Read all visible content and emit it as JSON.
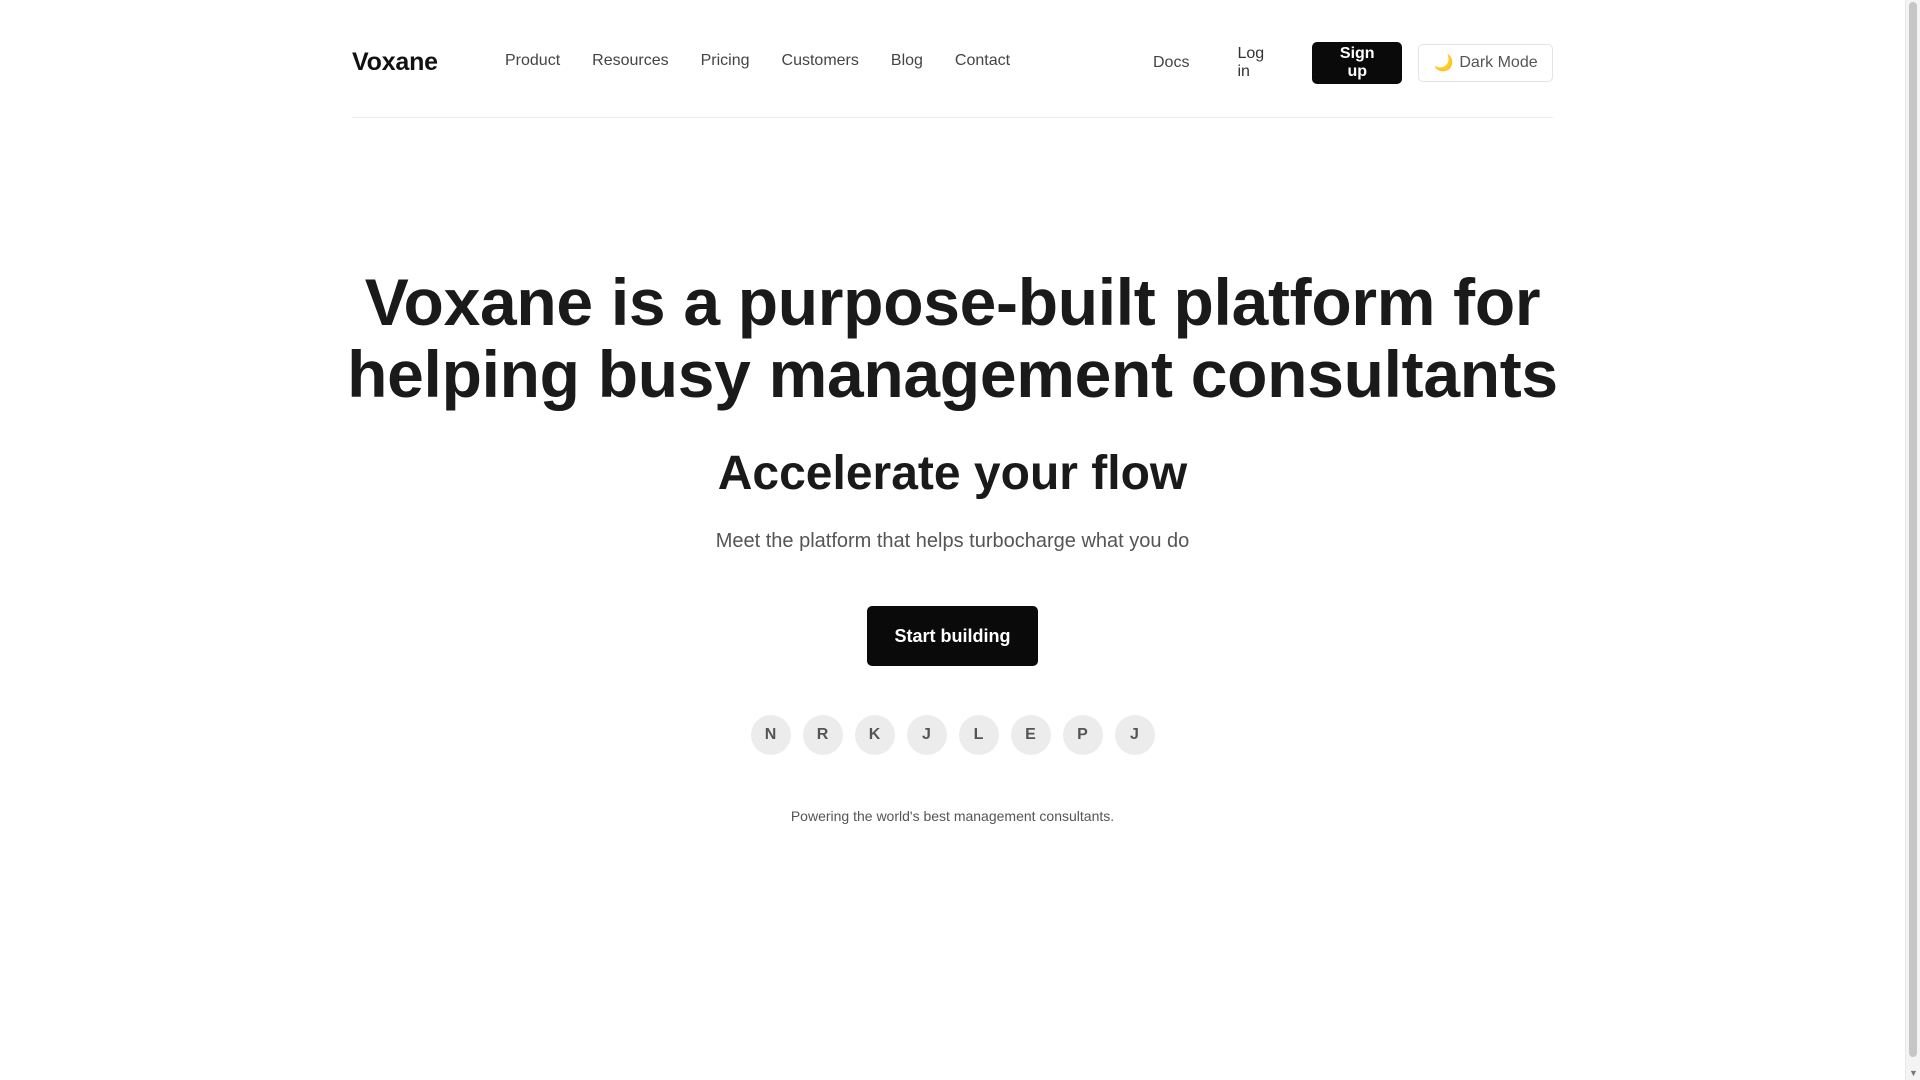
{
  "header": {
    "logo": "Voxane",
    "nav": [
      "Product",
      "Resources",
      "Pricing",
      "Customers",
      "Blog",
      "Contact"
    ],
    "docs": "Docs",
    "login": "Log in",
    "signup": "Sign up",
    "darkmode": "Dark Mode"
  },
  "hero": {
    "headline_line1": "Voxane is a purpose-built platform for",
    "headline_line2": "helping busy management consultants",
    "subheadline": "Accelerate your flow",
    "tagline": "Meet the platform that helps turbocharge what you do",
    "cta": "Start building",
    "avatars": [
      "N",
      "R",
      "K",
      "J",
      "L",
      "E",
      "P",
      "J"
    ],
    "powered_by": "Powering the world's best management consultants."
  },
  "icons": {
    "darkmode_icon": "moon-icon",
    "scroll_down_icon": "chevron-down-icon"
  }
}
